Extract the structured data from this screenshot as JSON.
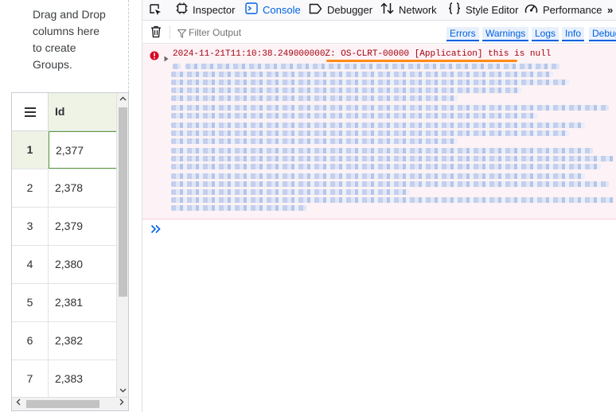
{
  "grid": {
    "group_drop_text": "Drag and Drop\ncolumns here\nto create\nGroups.",
    "menu_icon": "hamburger-menu-icon",
    "column_header": "Id",
    "rows": [
      {
        "num": "1",
        "id": "2,377",
        "selected": true
      },
      {
        "num": "2",
        "id": "2,378"
      },
      {
        "num": "3",
        "id": "2,379"
      },
      {
        "num": "4",
        "id": "2,380"
      },
      {
        "num": "5",
        "id": "2,381"
      },
      {
        "num": "6",
        "id": "2,382"
      },
      {
        "num": "7",
        "id": "2,383"
      }
    ]
  },
  "devtools": {
    "tabs": [
      {
        "id": "inspector",
        "label": "Inspector",
        "icon": "inspector-icon"
      },
      {
        "id": "console",
        "label": "Console",
        "icon": "console-icon",
        "active": true
      },
      {
        "id": "debugger",
        "label": "Debugger",
        "icon": "debugger-icon"
      },
      {
        "id": "network",
        "label": "Network",
        "icon": "network-icon"
      },
      {
        "id": "style-editor",
        "label": "Style Editor",
        "icon": "style-editor-icon"
      },
      {
        "id": "performance",
        "label": "Performance",
        "icon": "performance-icon"
      }
    ],
    "overflow_label": "»",
    "filter": {
      "placeholder": "Filter Output"
    },
    "filter_buttons": [
      "Errors",
      "Warnings",
      "Logs",
      "Info",
      "Debug"
    ],
    "error_message": {
      "timestamp": "2024-11-21T11:10:38.249000000Z:",
      "code": "OS-CLRT-00000",
      "text": "[Application] this is null"
    },
    "prompt_symbol": "»",
    "colors": {
      "accent": "#0061e0",
      "error_text": "#a4000f",
      "error_bg": "#fdf2f5",
      "underline": "#ff8c1a",
      "selected_row": "#eef3e6"
    }
  }
}
